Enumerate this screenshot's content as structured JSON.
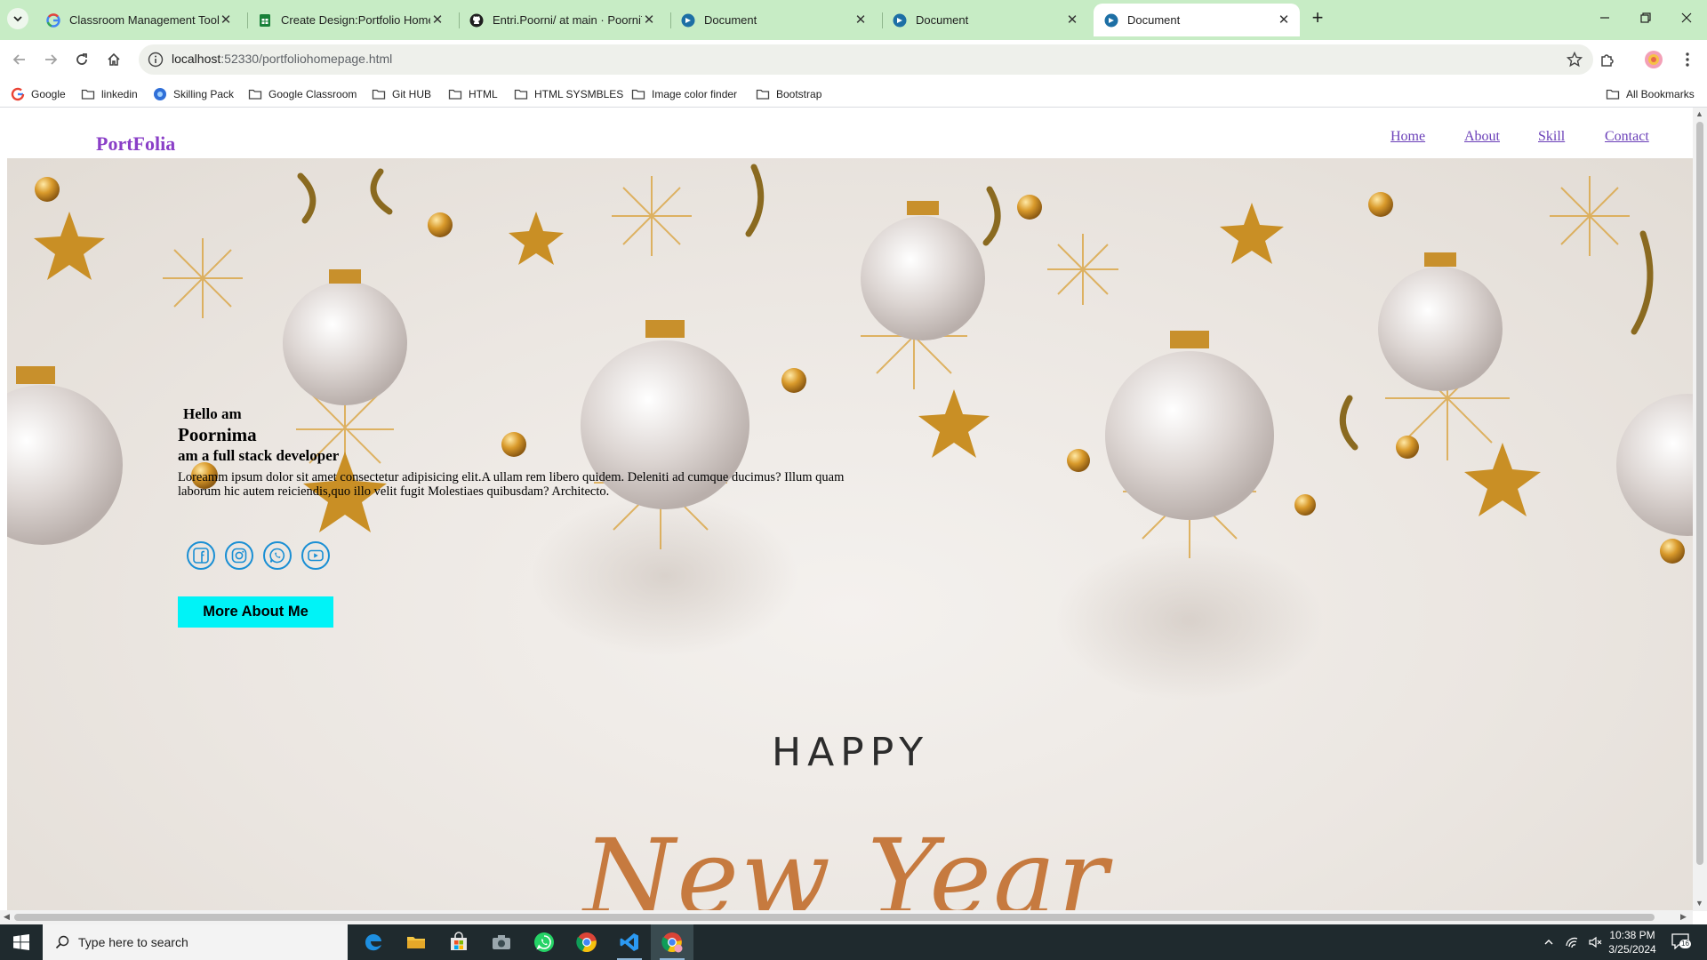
{
  "browser": {
    "tabs": [
      {
        "title": "Classroom Management Tools &",
        "favicon": "google-icon"
      },
      {
        "title": "Create Design:Portfolio Home p",
        "favicon": "sheets-icon"
      },
      {
        "title": "Entri.Poorni/ at main · PoorniTh",
        "favicon": "github-icon"
      },
      {
        "title": "Document",
        "favicon": "vscode-live-icon"
      },
      {
        "title": "Document",
        "favicon": "vscode-live-icon"
      },
      {
        "title": "Document",
        "favicon": "vscode-live-icon"
      }
    ],
    "address": {
      "host": "localhost",
      "path": ":52330/portfoliohomepage.html"
    },
    "bookmarks": [
      {
        "label": "Google",
        "icon": "google-icon"
      },
      {
        "label": "linkedin",
        "icon": "folder-icon"
      },
      {
        "label": "Skilling Pack",
        "icon": "skilling-icon"
      },
      {
        "label": "Google Classroom",
        "icon": "folder-icon"
      },
      {
        "label": "Git HUB",
        "icon": "folder-icon"
      },
      {
        "label": "HTML",
        "icon": "folder-icon"
      },
      {
        "label": "HTML SYSMBLES",
        "icon": "folder-icon"
      },
      {
        "label": "Image color finder",
        "icon": "folder-icon"
      },
      {
        "label": "Bootstrap",
        "icon": "folder-icon"
      }
    ],
    "all_bookmarks": "All Bookmarks"
  },
  "page": {
    "logo": "PortFolia",
    "nav": [
      "Home",
      "About",
      "Skill",
      "Contact"
    ],
    "hero": {
      "greeting": "Hello am",
      "name": "Poornima",
      "role": "am a full stack developer",
      "description": "Loreamm ipsum dolor sit amet consectetur adipisicing elit.A ullam rem libero quidem. Deleniti ad cumque ducimus? Illum quam laborum hic autem reiciendis,quo illo velit fugit Molestiaes quibusdam? Architecto.",
      "social": [
        "facebook-icon",
        "instagram-icon",
        "whatsapp-icon",
        "youtube-icon"
      ],
      "cta": "More About Me"
    },
    "banner": {
      "line1": "HAPPY",
      "line2": "New Year"
    }
  },
  "taskbar": {
    "search_placeholder": "Type here to search",
    "apps": [
      "edge-icon",
      "file-explorer-icon",
      "store-icon",
      "camera-icon",
      "whatsapp-icon",
      "chrome-icon",
      "vscode-icon",
      "chrome-profile-icon"
    ],
    "time": "10:38 PM",
    "date": "3/25/2024",
    "notification_count": "16"
  },
  "colors": {
    "accent_purple": "#8a3fc7",
    "link_purple": "#6a3fb8",
    "cta_cyan": "#00f3f7",
    "social_blue": "#1a8fd4",
    "tabbar_green": "#c7ecc5"
  }
}
